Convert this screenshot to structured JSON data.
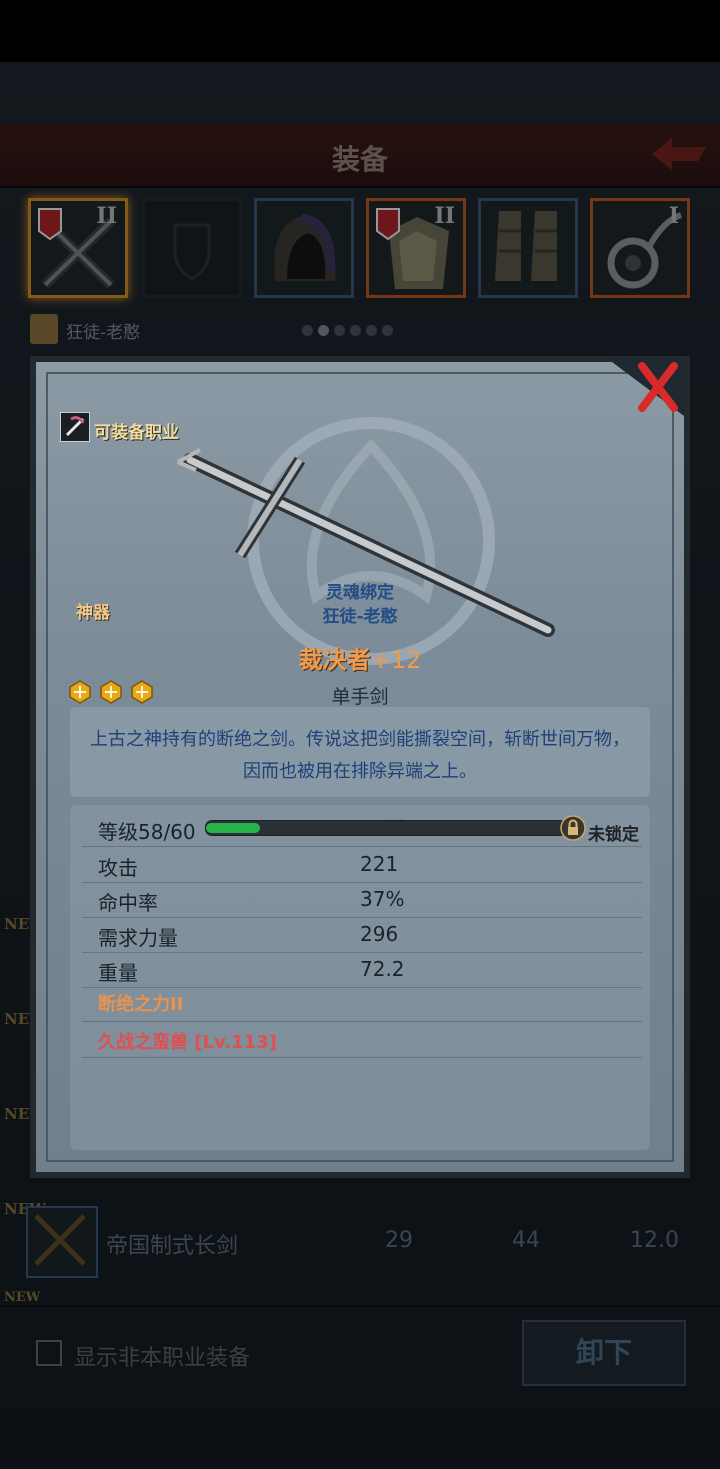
{
  "header": {
    "title": "装备"
  },
  "equip_slots": [
    {
      "icon": "cross-sword-icon",
      "tier": "II",
      "selected": true
    },
    {
      "icon": "shield-placeholder-icon",
      "tier": "",
      "empty": true
    },
    {
      "icon": "hood-icon",
      "tier": ""
    },
    {
      "icon": "armor-icon",
      "tier": "II"
    },
    {
      "icon": "boots-icon",
      "tier": ""
    },
    {
      "icon": "amulet-icon",
      "tier": "I"
    }
  ],
  "character": {
    "name": "狂徒-老憨"
  },
  "page_dots": {
    "total": 6,
    "active": 1
  },
  "item": {
    "class_label": "可装备职业",
    "rarity": "神器",
    "bound_label": "灵魂绑定",
    "bound_owner": "狂徒-老憨",
    "name": "裁决者",
    "enhance": "+12",
    "type": "单手剑",
    "stars": 3,
    "description": "上古之神持有的断绝之剑。传说这把剑能撕裂空间，斩断世间万物，因而也被用在排除异端之上。",
    "level_label": "等级58/60",
    "level_progress_percent": 15,
    "level_progress_text": "15%",
    "lock_label": "未锁定",
    "stats": [
      {
        "label": "攻击",
        "value": "221"
      },
      {
        "label": "命中率",
        "value": "37%"
      },
      {
        "label": "需求力量",
        "value": "296"
      },
      {
        "label": "重量",
        "value": "72.2"
      }
    ],
    "skill1": "断绝之力II",
    "skill2": "久战之蛮兽 [Lv.113]"
  },
  "list_item": {
    "new_tag": "NEW",
    "name": "帝国制式长剑",
    "values": [
      "29",
      "44",
      "12.0"
    ]
  },
  "new_tags": [
    "NEW",
    "NEW",
    "NEW",
    "NEW"
  ],
  "footer": {
    "checkbox_label": "显示非本职业装备",
    "unequip_label": "卸下"
  },
  "colors": {
    "accent_orange": "#ef9b4c",
    "skill_red": "#e05050",
    "bound_blue": "#244c86"
  }
}
